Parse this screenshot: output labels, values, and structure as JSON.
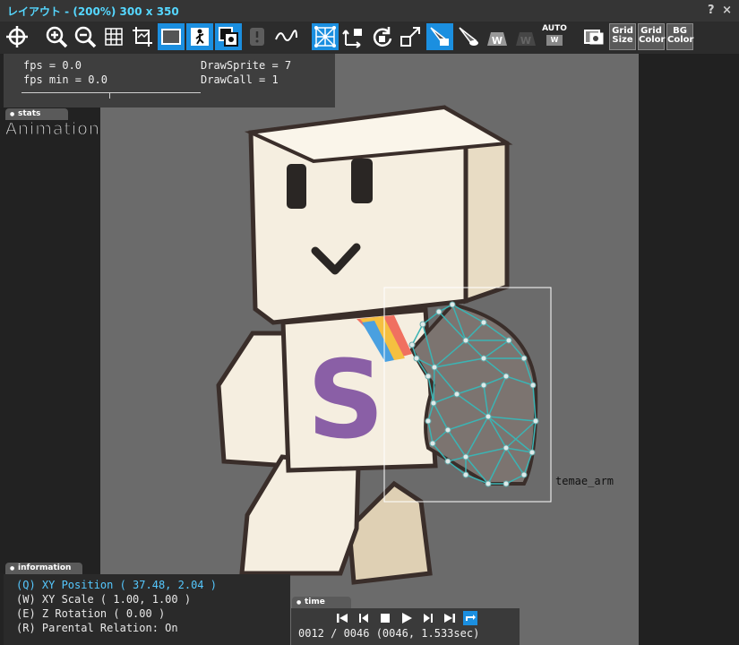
{
  "window": {
    "title": "レイアウト - (200%) 300 x 350",
    "help_glyph": "?",
    "close_glyph": "×"
  },
  "toolbar": {
    "items": [
      {
        "name": "move-view-icon",
        "active": false
      },
      {
        "name": "zoom-in-icon",
        "active": false
      },
      {
        "name": "zoom-out-icon",
        "active": false
      },
      {
        "name": "grid-icon",
        "active": false
      },
      {
        "name": "crop-icon",
        "active": false
      },
      {
        "name": "frame-icon",
        "active": true
      },
      {
        "name": "figure-icon",
        "active": true
      },
      {
        "name": "layer-icon",
        "active": true
      },
      {
        "name": "pin-icon",
        "active": false,
        "disabled": true
      },
      {
        "name": "curve-icon",
        "active": false
      },
      {
        "name": "mesh-icon",
        "active": true
      },
      {
        "name": "move-lock-icon",
        "active": false
      },
      {
        "name": "rotate-lock-icon",
        "active": false
      },
      {
        "name": "scale-lock-icon",
        "active": false
      },
      {
        "name": "bone-lock-icon",
        "active": true
      },
      {
        "name": "bone-view-icon",
        "active": false
      },
      {
        "name": "weight-icon",
        "active": false
      },
      {
        "name": "weight-lock-icon",
        "active": false,
        "disabled": true
      }
    ],
    "auto_label": "AUTO",
    "auto_sub": "W",
    "grid_size": [
      "Grid",
      "Size"
    ],
    "grid_color": [
      "Grid",
      "Color"
    ],
    "bg_color": [
      "BG",
      "Color"
    ]
  },
  "fps": {
    "fps": "fps = 0.0",
    "fps_min": "fps min = 0.0",
    "draw_sprite": "DrawSprite = 7",
    "draw_call": "DrawCall = 1"
  },
  "panels": {
    "stats_tab": "stats",
    "animation_label": "Animation",
    "information_tab": "information",
    "time_tab": "time"
  },
  "information": {
    "position": "(Q) XY Position ( 37.48, 2.04 )",
    "scale": "(W) XY Scale ( 1.00, 1.00 )",
    "rotation": "(E) Z Rotation ( 0.00 )",
    "parental": "(R) Parental Relation: On"
  },
  "time": {
    "readout": "0012 / 0046 (0046, 1.533sec)"
  },
  "canvas": {
    "selected_part_label": "temae_arm",
    "shirt_letter": "S",
    "colors": {
      "body": "#f5eee0",
      "body_shade": "#dfd0b4",
      "outline": "#3a2e2a",
      "mesh": "#3bb4b4",
      "letter": "#8a5fa6",
      "accent": "#1b8fe0"
    }
  }
}
